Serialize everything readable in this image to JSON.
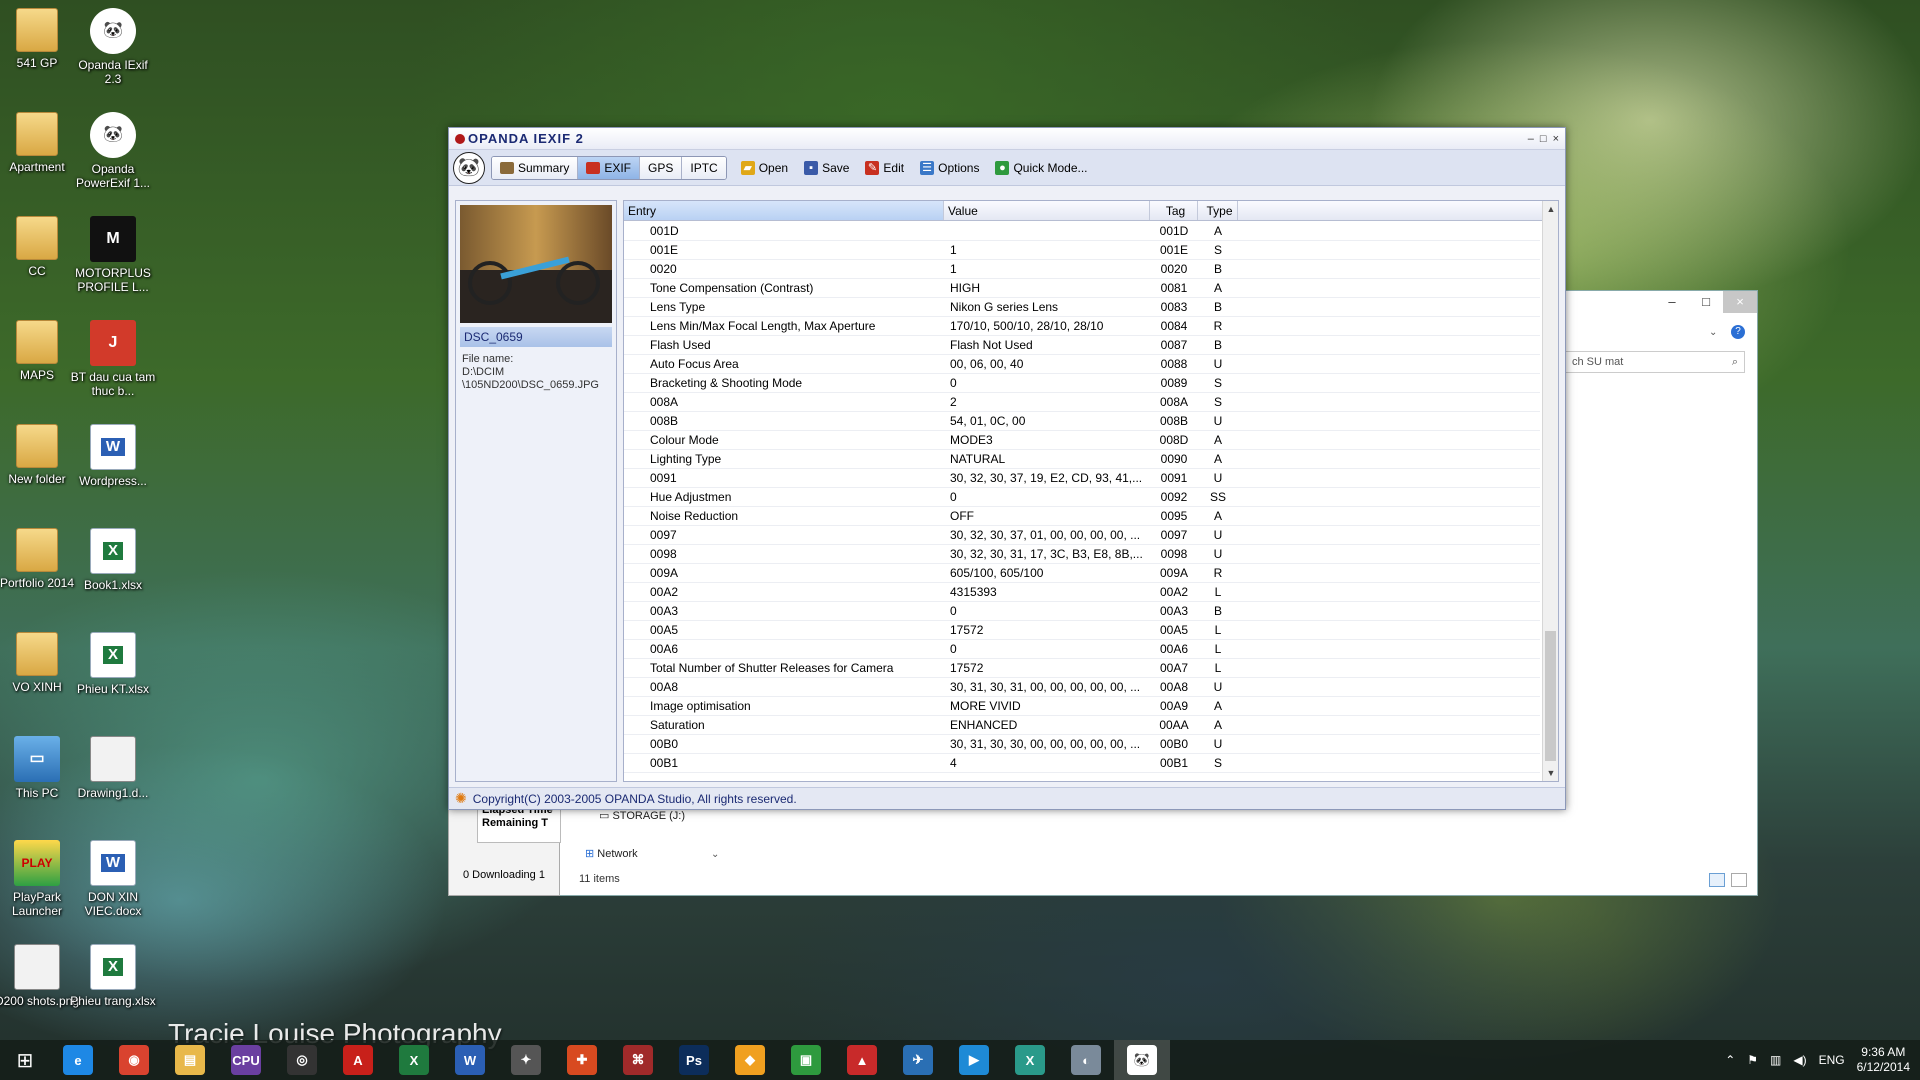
{
  "desktop": {
    "icons": [
      {
        "label": "541 GP",
        "icon": "folder-icon"
      },
      {
        "label": "Opanda IExif 2.3",
        "icon": "panda-icon"
      },
      {
        "label": "Apartment",
        "icon": "folder-icon"
      },
      {
        "label": "Opanda PowerExif 1...",
        "icon": "panda-icon"
      },
      {
        "label": "CC",
        "icon": "folder-icon"
      },
      {
        "label": "MOTORPLUS PROFILE L...",
        "icon": "motorplus-icon"
      },
      {
        "label": "MAPS",
        "icon": "folder-icon"
      },
      {
        "label": "BT dau cua tam thuc b...",
        "icon": "pdf-icon"
      },
      {
        "label": "New folder",
        "icon": "folder-icon"
      },
      {
        "label": "Wordpress...",
        "icon": "word-doc-icon"
      },
      {
        "label": "Portfolio 2014",
        "icon": "folder-icon"
      },
      {
        "label": "Book1.xlsx",
        "icon": "excel-doc-icon"
      },
      {
        "label": "VO XINH",
        "icon": "folder-icon"
      },
      {
        "label": "Phieu KT.xlsx",
        "icon": "excel-doc-icon"
      },
      {
        "label": "This PC",
        "icon": "computer-icon"
      },
      {
        "label": "Drawing1.d...",
        "icon": "drawing-icon"
      },
      {
        "label": "PlayPark Launcher",
        "icon": "playpark-icon"
      },
      {
        "label": "DON XIN VIEC.docx",
        "icon": "word-doc-icon"
      },
      {
        "label": "D200 shots.png",
        "icon": "image-icon"
      },
      {
        "label": "Phieu trang.xlsx",
        "icon": "excel-doc-icon"
      }
    ],
    "watermark": "Tracie Louise Photography"
  },
  "background_explorer": {
    "search_placeholder": "ch SU mat",
    "nav_items": [
      {
        "label": "STORAGE (J:)",
        "icon": "drive-icon"
      },
      {
        "label": "Network",
        "icon": "network-icon"
      }
    ],
    "status": "11 items"
  },
  "download_panel": {
    "labels": [
      "Elapsed Time",
      "Remaining T"
    ],
    "status": "0 Downloading  1"
  },
  "app": {
    "title": "OPANDA IEXIF 2",
    "window_controls": [
      "–",
      "□",
      "×"
    ],
    "tabs": [
      {
        "label": "Summary",
        "active": false
      },
      {
        "label": "EXIF",
        "active": true
      },
      {
        "label": "GPS",
        "active": false
      },
      {
        "label": "IPTC",
        "active": false
      }
    ],
    "actions": [
      {
        "label": "Open",
        "icon": "open-folder-icon",
        "color": "#e0a818"
      },
      {
        "label": "Save",
        "icon": "save-disk-icon",
        "color": "#3a5aa8"
      },
      {
        "label": "Edit",
        "icon": "edit-icon",
        "color": "#c83020"
      },
      {
        "label": "Options",
        "icon": "options-icon",
        "color": "#3a78c8"
      },
      {
        "label": "Quick Mode...",
        "icon": "quick-mode-icon",
        "color": "#2e9a3e"
      }
    ],
    "file": {
      "title": "DSC_0659",
      "info": "File name:\nD:\\DCIM\n\\105ND200\\DSC_0659.JPG"
    },
    "table": {
      "columns": [
        "Entry",
        "Value",
        "Tag",
        "Type"
      ],
      "rows": [
        [
          "001D",
          "",
          "001D",
          "A"
        ],
        [
          "001E",
          "1",
          "001E",
          "S"
        ],
        [
          "0020",
          "1",
          "0020",
          "B"
        ],
        [
          "Tone Compensation (Contrast)",
          "HIGH",
          "0081",
          "A"
        ],
        [
          "Lens Type",
          "Nikon G series Lens",
          "0083",
          "B"
        ],
        [
          "Lens Min/Max Focal Length, Max Aperture",
          "170/10, 500/10, 28/10, 28/10",
          "0084",
          "R"
        ],
        [
          "Flash Used",
          "Flash Not Used",
          "0087",
          "B"
        ],
        [
          "Auto Focus Area",
          "00, 06, 00, 40",
          "0088",
          "U"
        ],
        [
          "Bracketing & Shooting Mode",
          "0",
          "0089",
          "S"
        ],
        [
          "008A",
          "2",
          "008A",
          "S"
        ],
        [
          "008B",
          "54, 01, 0C, 00",
          "008B",
          "U"
        ],
        [
          "Colour Mode",
          "MODE3",
          "008D",
          "A"
        ],
        [
          "Lighting Type",
          "NATURAL",
          "0090",
          "A"
        ],
        [
          "0091",
          "30, 32, 30, 37, 19, E2, CD, 93, 41,...",
          "0091",
          "U"
        ],
        [
          "Hue Adjustmen",
          "0",
          "0092",
          "SS"
        ],
        [
          "Noise Reduction",
          "OFF",
          "0095",
          "A"
        ],
        [
          "0097",
          "30, 32, 30, 37, 01, 00, 00, 00, 00, ...",
          "0097",
          "U"
        ],
        [
          "0098",
          "30, 32, 30, 31, 17, 3C, B3, E8, 8B,...",
          "0098",
          "U"
        ],
        [
          "009A",
          "605/100, 605/100",
          "009A",
          "R"
        ],
        [
          "00A2",
          "4315393",
          "00A2",
          "L"
        ],
        [
          "00A3",
          "0",
          "00A3",
          "B"
        ],
        [
          "00A5",
          "17572",
          "00A5",
          "L"
        ],
        [
          "00A6",
          "0",
          "00A6",
          "L"
        ],
        [
          "Total Number of Shutter Releases for Camera",
          "17572",
          "00A7",
          "L"
        ],
        [
          "00A8",
          "30, 31, 30, 31, 00, 00, 00, 00, 00, ...",
          "00A8",
          "U"
        ],
        [
          "Image optimisation",
          "MORE VIVID",
          "00A9",
          "A"
        ],
        [
          "Saturation",
          "ENHANCED",
          "00AA",
          "A"
        ],
        [
          "00B0",
          "30, 31, 30, 30, 00, 00, 00, 00, 00, ...",
          "00B0",
          "U"
        ],
        [
          "00B1",
          "4",
          "00B1",
          "S"
        ]
      ]
    },
    "status": "Copyright(C) 2003-2005 OPANDA Studio, All rights reserved."
  },
  "taskbar": {
    "apps": [
      {
        "icon": "internet-explorer-icon",
        "glyph": "e",
        "color": "#1e88e5"
      },
      {
        "icon": "chrome-icon",
        "glyph": "◉",
        "color": "#d9432f"
      },
      {
        "icon": "file-explorer-icon",
        "glyph": "▤",
        "color": "#e8b84a"
      },
      {
        "icon": "cpu-z-icon",
        "glyph": "CPU",
        "color": "#6a3fa0"
      },
      {
        "icon": "camera-app-icon",
        "glyph": "◎",
        "color": "#333333"
      },
      {
        "icon": "acrobat-icon",
        "glyph": "A",
        "color": "#c8201a"
      },
      {
        "icon": "excel-icon",
        "glyph": "X",
        "color": "#1f7a3e"
      },
      {
        "icon": "word-icon",
        "glyph": "W",
        "color": "#2b5fb4"
      },
      {
        "icon": "security-icon",
        "glyph": "✦",
        "color": "#555555"
      },
      {
        "icon": "shield-icon",
        "glyph": "✚",
        "color": "#d84a20"
      },
      {
        "icon": "puzzle-icon",
        "glyph": "⌘",
        "color": "#a02a2a"
      },
      {
        "icon": "photoshop-icon",
        "glyph": "Ps",
        "color": "#0c2d5a"
      },
      {
        "icon": "layers-icon",
        "glyph": "◆",
        "color": "#f0a020"
      },
      {
        "icon": "store-icon",
        "glyph": "▣",
        "color": "#2e9a3e"
      },
      {
        "icon": "sketchup-icon",
        "glyph": "▲",
        "color": "#c82a2a"
      },
      {
        "icon": "airplane-icon",
        "glyph": "✈",
        "color": "#2a6fb4"
      },
      {
        "icon": "media-player-icon",
        "glyph": "▶",
        "color": "#1e8ad6"
      },
      {
        "icon": "x-app-icon",
        "glyph": "X",
        "color": "#2a9a8a"
      },
      {
        "icon": "gauge-icon",
        "glyph": "◐",
        "color": "#7a8a9a"
      },
      {
        "icon": "panda-app-icon",
        "glyph": "🐼",
        "color": "#ffffff",
        "active": true
      }
    ],
    "tray": {
      "language": "ENG",
      "time": "9:36 AM",
      "date": "6/12/2014"
    }
  }
}
